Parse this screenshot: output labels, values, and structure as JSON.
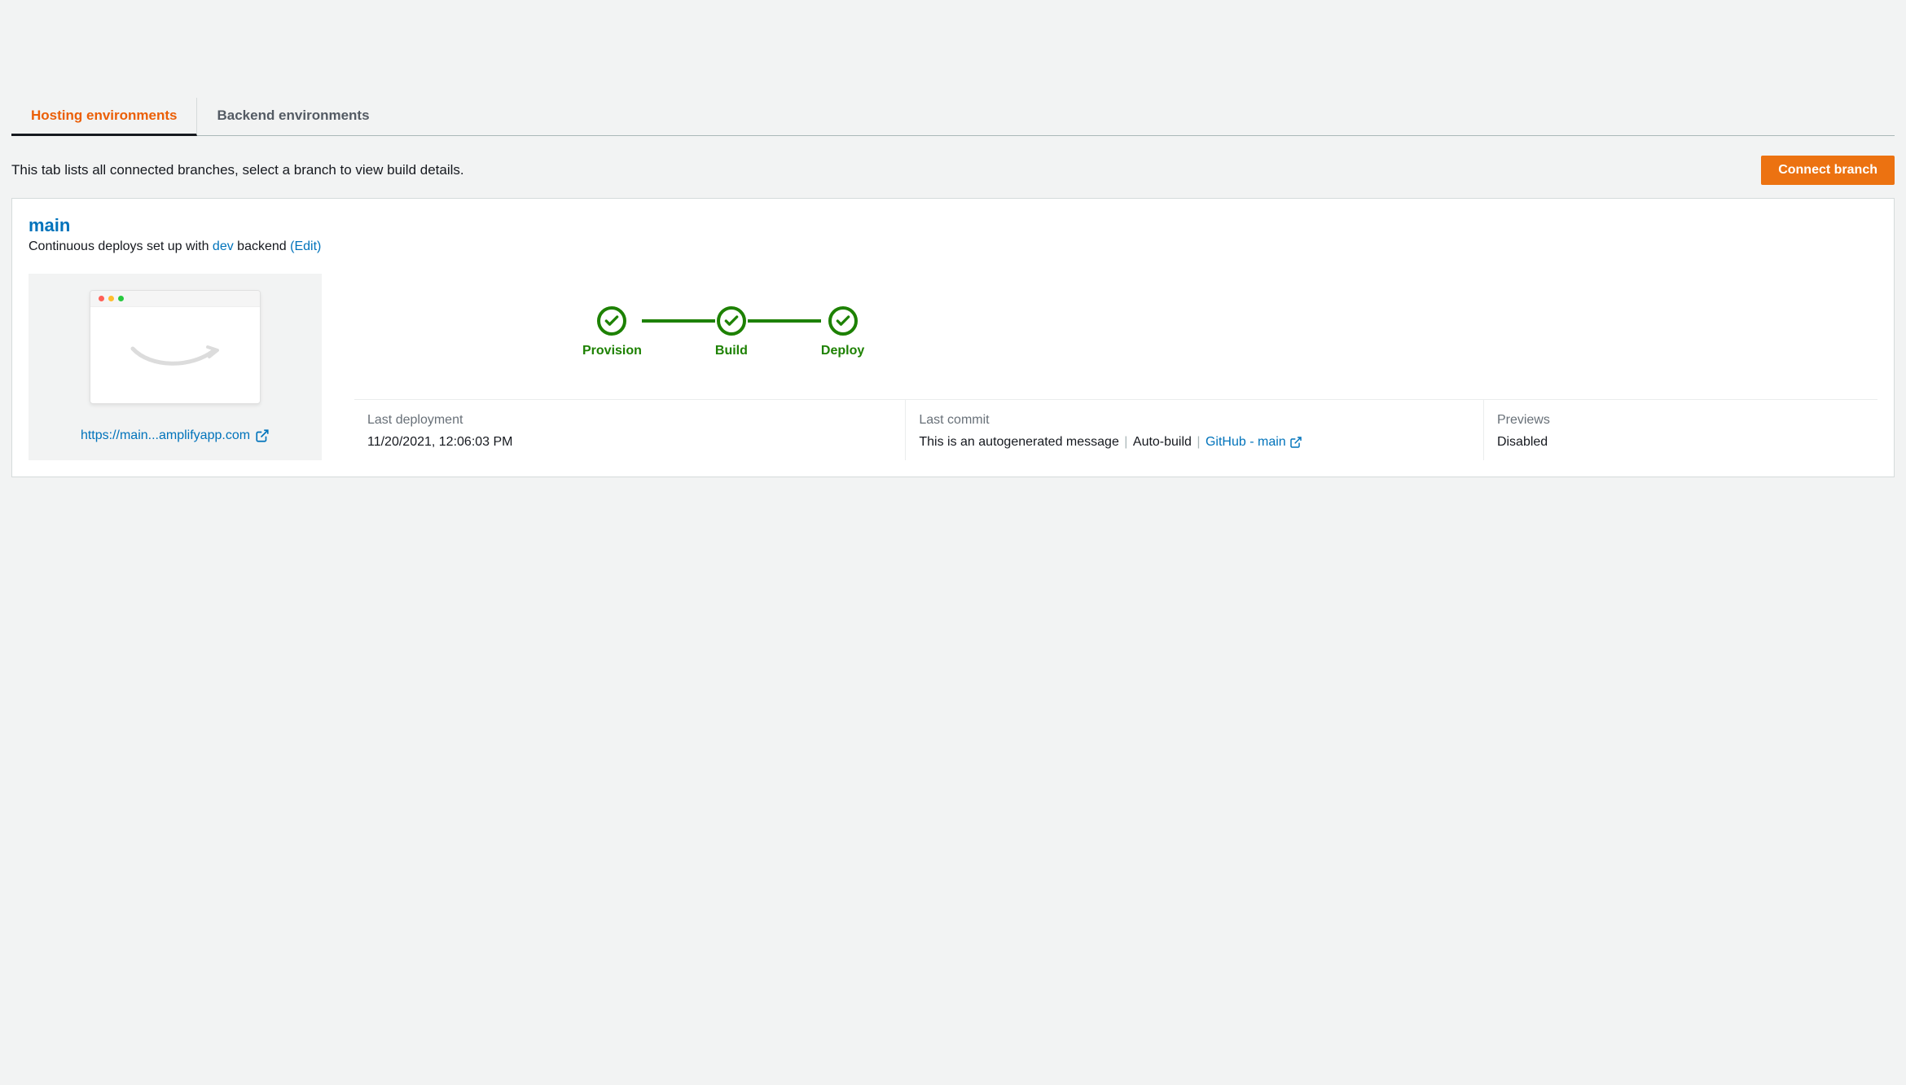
{
  "tabs": [
    {
      "label": "Hosting environments",
      "active": true
    },
    {
      "label": "Backend environments",
      "active": false
    }
  ],
  "description": "This tab lists all connected branches, select a branch to view build details.",
  "connect_button": "Connect branch",
  "branch": {
    "name": "main",
    "subtext_prefix": "Continuous deploys set up with ",
    "backend_name": "dev",
    "subtext_suffix": " backend ",
    "edit_label": "(Edit)",
    "preview_url": "https://main...amplifyapp.com"
  },
  "pipeline": {
    "steps": [
      "Provision",
      "Build",
      "Deploy"
    ]
  },
  "details": {
    "last_deployment": {
      "label": "Last deployment",
      "value": "11/20/2021, 12:06:03 PM"
    },
    "last_commit": {
      "label": "Last commit",
      "message": "This is an autogenerated message",
      "build_type": "Auto-build",
      "source_link": "GitHub - main"
    },
    "previews": {
      "label": "Previews",
      "value": "Disabled"
    }
  }
}
